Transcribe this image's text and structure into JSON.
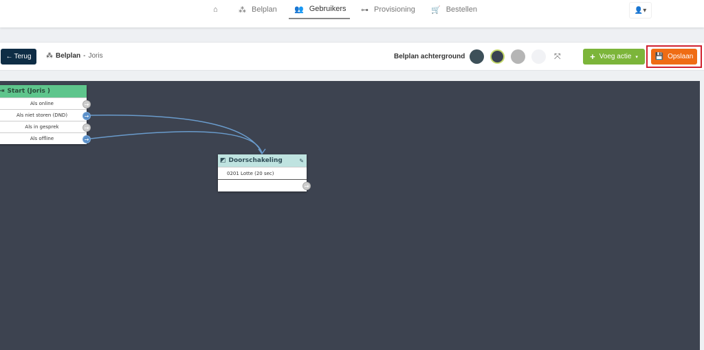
{
  "nav": {
    "items": [
      {
        "icon": "home-icon",
        "label": ""
      },
      {
        "icon": "sitemap-icon",
        "label": "Belplan"
      },
      {
        "icon": "users-icon",
        "label": "Gebruikers",
        "active": true
      },
      {
        "icon": "network-icon",
        "label": "Provisioning"
      },
      {
        "icon": "cart-icon",
        "label": "Bestellen"
      }
    ],
    "user_icon": "user-icon"
  },
  "toolbar": {
    "back_label": "Terug",
    "breadcrumb_title": "Belplan",
    "breadcrumb_sep": "-",
    "breadcrumb_user": "Joris",
    "background_label": "Belplan achterground",
    "swatches": [
      "#3d5059",
      "#3a4352",
      "#b5b5b5",
      "#f1f2f5"
    ],
    "add_label": "Voeg actie",
    "save_label": "Opslaan"
  },
  "canvas": {
    "background": "#3d4350",
    "start_node": {
      "title": "Start (Joris )",
      "rows": [
        {
          "label": "Als online",
          "connected": false
        },
        {
          "label": "Als niet storen (DND)",
          "connected": true
        },
        {
          "label": "Als in gesprek",
          "connected": false
        },
        {
          "label": "Als offline",
          "connected": true
        }
      ]
    },
    "forward_node": {
      "title": "Doorschakeling",
      "rows": [
        "0201 Lotte (20 sec)",
        ""
      ]
    }
  }
}
